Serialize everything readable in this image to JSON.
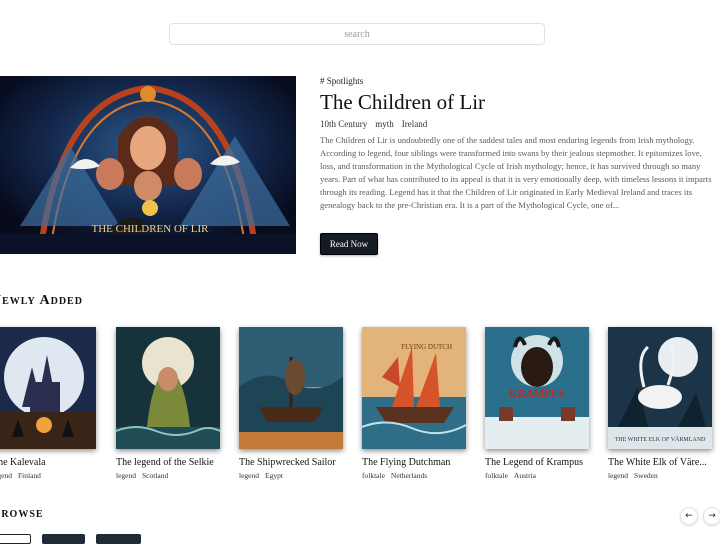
{
  "search": {
    "placeholder": "search"
  },
  "spotlight": {
    "tag": "# Spotlights",
    "title": "The Children of Lir",
    "century": "10th Century",
    "category": "myth",
    "country": "Ireland",
    "description": "The Children of Lir is undoubtedly one of the saddest tales and most enduring legends from Irish mythology. According to legend, four siblings were transformed into swans by their jealous stepmother. It epitomizes love, loss, and transformation in the Mythological Cycle of Irish mythology; hence, it has survived through so many years. Part of what has contributed to its appeal is that it is very emotionally deep, with timeless lessons it imparts through its reading. Legend has it that the Children of Lir originated in Early Medieval Ireland and traces its genealogy back to the pre-Christian era. It is a part of the Mythological Cycle, one of...",
    "cover_text": "THE CHILDREN OF LIR",
    "button": "Read Now"
  },
  "newly_added": {
    "heading": "Newly Added",
    "items": [
      {
        "title": "The Kalevala",
        "category": "legend",
        "country": "Finland"
      },
      {
        "title": "The legend of the Selkie",
        "category": "legend",
        "country": "Scotland"
      },
      {
        "title": "The Shipwrecked Sailor",
        "category": "legend",
        "country": "Egypt"
      },
      {
        "title": "The Flying Dutchman",
        "category": "folktale",
        "country": "Netherlands",
        "cover_text": "FLYING DUTCH"
      },
      {
        "title": "The Legend of Krampus",
        "category": "folktale",
        "country": "Austria",
        "cover_text": "KRAMPUS"
      },
      {
        "title": "The White Elk of Väre...",
        "category": "legend",
        "country": "Sweden",
        "cover_text": "THE WHITE ELK OF VÄRMLAND"
      }
    ]
  },
  "browse": {
    "heading": "Browse",
    "prev_icon": "←",
    "next_icon": "→"
  },
  "colors": {
    "button_bg": "#151b22",
    "text": "#1b1b1b",
    "muted": "#5a5a5a"
  }
}
